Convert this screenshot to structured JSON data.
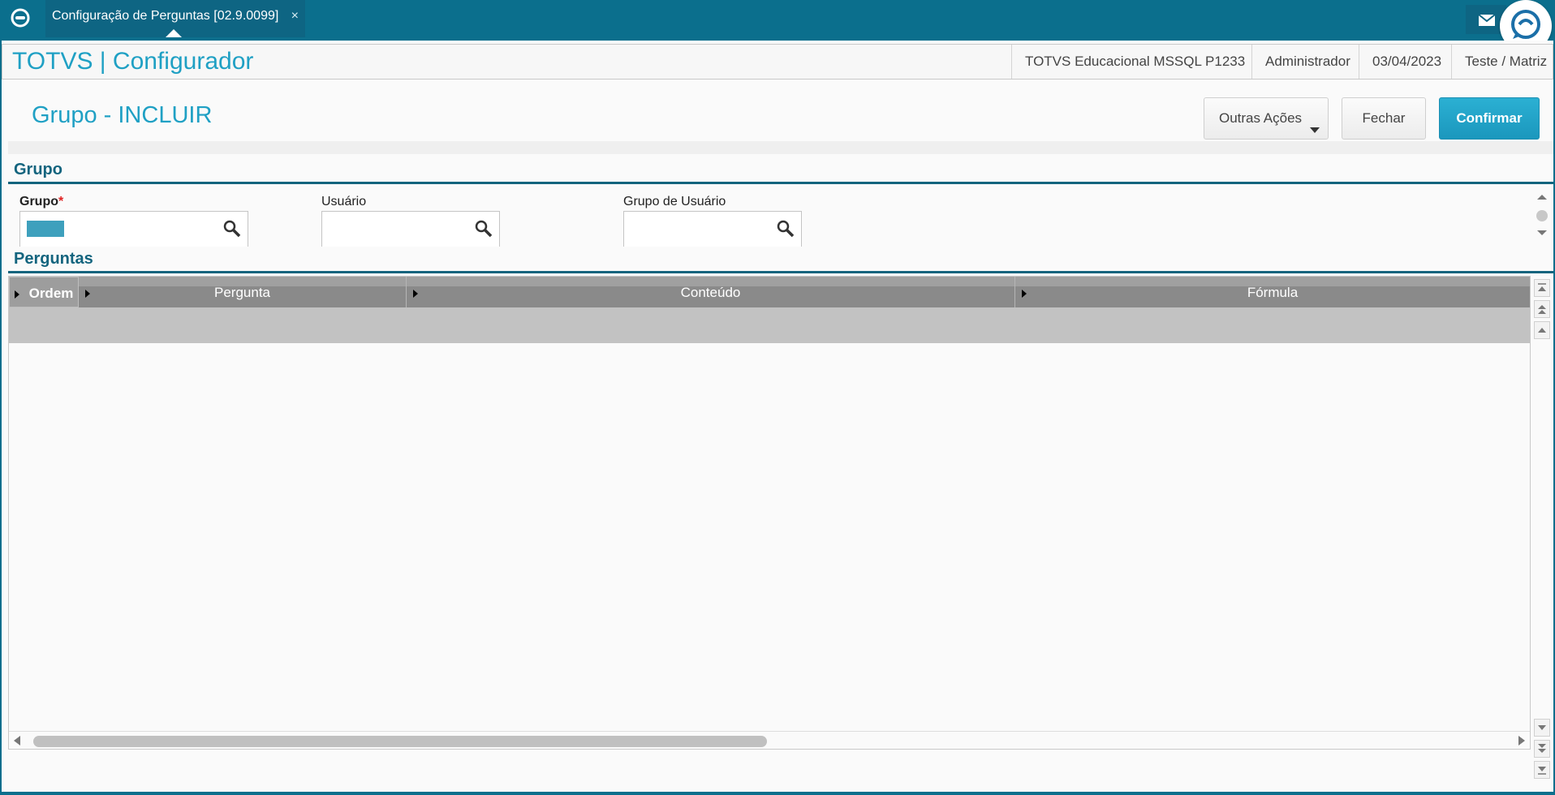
{
  "tabbar": {
    "tab_title": "Configuração de Perguntas [02.9.0099]",
    "tab_close": "×"
  },
  "header": {
    "app_name": "TOTVS | Configurador",
    "environment": "TOTVS Educacional MSSQL P1233",
    "user": "Administrador",
    "date": "03/04/2023",
    "branch": "Teste / Matriz"
  },
  "page": {
    "title": "Grupo - INCLUIR"
  },
  "actions": {
    "other_actions": "Outras Ações",
    "close": "Fechar",
    "confirm": "Confirmar"
  },
  "section_grupo": {
    "title": "Grupo",
    "fields": {
      "grupo_label": "Grupo",
      "grupo_required": "*",
      "usuario_label": "Usuário",
      "grupo_usuario_label": "Grupo de Usuário"
    }
  },
  "section_perguntas": {
    "title": "Perguntas",
    "columns": [
      "Ordem",
      "Pergunta",
      "Conteúdo",
      "Fórmula"
    ]
  },
  "colors": {
    "brand": "#0b6f8d",
    "accent": "#1fa0c4",
    "section": "#13647e",
    "required": "#e02020"
  },
  "icons": [
    "totvs-logo-icon",
    "close-icon",
    "mail-icon",
    "chat-assistant-icon",
    "search-icon",
    "chevron-down-icon",
    "scroll-up-icon",
    "scroll-down-icon",
    "scroll-top-icon",
    "scroll-bottom-icon"
  ]
}
